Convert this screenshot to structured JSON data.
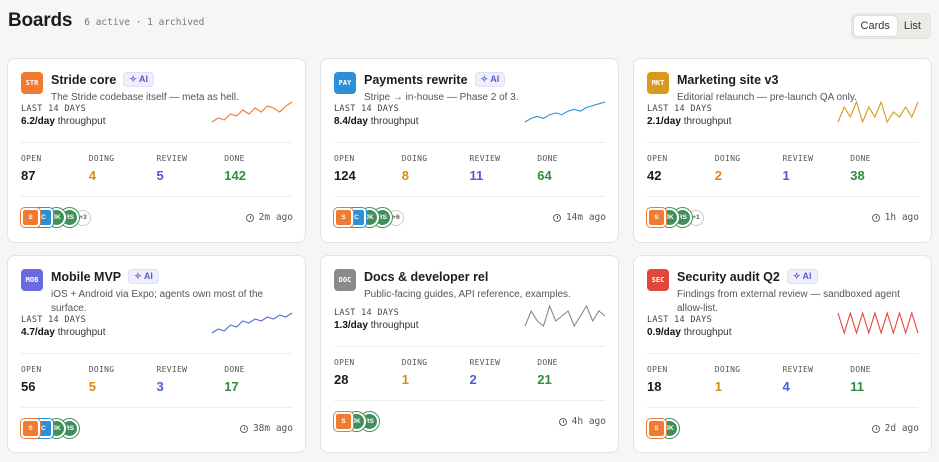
{
  "header": {
    "title": "Boards",
    "subtitle": "6 active · 1 archived"
  },
  "view_toggle": {
    "options": [
      "Cards",
      "List"
    ],
    "active": "Cards"
  },
  "labels": {
    "last14": "LAST 14 DAYS",
    "throughput_suffix": "throughput",
    "open": "OPEN",
    "doing": "DOING",
    "review": "REVIEW",
    "done": "DONE",
    "ai": "✧ AI"
  },
  "colors": {
    "doing": "#d98a12",
    "review": "#4f5bd5",
    "done": "#2f8f3f",
    "ai": "#5b5bd6"
  },
  "boards": [
    {
      "code": "STR",
      "code_color": "#f07a2f",
      "name": "Stride core",
      "ai": true,
      "description": "The Stride codebase itself — meta as hell.",
      "rate": "6.2/day",
      "spark_color": "#f07a2f",
      "spark": [
        3,
        4,
        3.5,
        5,
        4.5,
        6,
        5,
        6.5,
        5.5,
        7,
        6.5,
        5.5,
        7,
        8
      ],
      "open": "87",
      "doing": "4",
      "review": "5",
      "done": "142",
      "avatars": [
        {
          "initials": "S",
          "color": "#f07a2f",
          "shape": "square"
        },
        {
          "initials": "C",
          "color": "#2c8fd8",
          "shape": "square"
        },
        {
          "initials": "JK",
          "color": "#3f8f5a",
          "shape": "circle"
        },
        {
          "initials": "RS",
          "color": "#3f8f5a",
          "shape": "circle"
        }
      ],
      "more": "+3",
      "updated": "2m ago"
    },
    {
      "code": "PAY",
      "code_color": "#2c8fd8",
      "name": "Payments rewrite",
      "ai": true,
      "description": "Stripe → in-house — Phase 2 of 3.",
      "rate": "8.4/day",
      "spark_color": "#2c8fd8",
      "spark": [
        2,
        3,
        3.5,
        3,
        4,
        4.5,
        4,
        5,
        5.5,
        5,
        6,
        6.5,
        7,
        7.5
      ],
      "open": "124",
      "doing": "8",
      "review": "11",
      "done": "64",
      "avatars": [
        {
          "initials": "S",
          "color": "#f07a2f",
          "shape": "square"
        },
        {
          "initials": "C",
          "color": "#2c8fd8",
          "shape": "square"
        },
        {
          "initials": "JK",
          "color": "#3f8f5a",
          "shape": "circle"
        },
        {
          "initials": "RS",
          "color": "#3f8f5a",
          "shape": "circle"
        }
      ],
      "more": "+6",
      "updated": "14m ago"
    },
    {
      "code": "MKT",
      "code_color": "#d99a1b",
      "name": "Marketing site v3",
      "ai": false,
      "description": "Editorial relaunch — pre-launch QA only.",
      "rate": "2.1/day",
      "spark_color": "#d99a1b",
      "spark": [
        3,
        6,
        4,
        7,
        3,
        6,
        4,
        7,
        3,
        5,
        4,
        6,
        4,
        7
      ],
      "open": "42",
      "doing": "2",
      "review": "1",
      "done": "38",
      "avatars": [
        {
          "initials": "S",
          "color": "#f07a2f",
          "shape": "square"
        },
        {
          "initials": "JK",
          "color": "#3f8f5a",
          "shape": "circle"
        },
        {
          "initials": "RS",
          "color": "#3f8f5a",
          "shape": "circle"
        }
      ],
      "more": "+1",
      "updated": "1h ago"
    },
    {
      "code": "MOB",
      "code_color": "#6a6ae0",
      "name": "Mobile MVP",
      "ai": true,
      "description": "iOS + Android via Expo; agents own most of the surface.",
      "rate": "4.7/day",
      "spark_color": "#4f6fd8",
      "spark": [
        2,
        3,
        2.5,
        4,
        3.5,
        5,
        4.5,
        5.5,
        5,
        6,
        5.5,
        6.5,
        6,
        7
      ],
      "open": "56",
      "doing": "5",
      "review": "3",
      "done": "17",
      "avatars": [
        {
          "initials": "S",
          "color": "#f07a2f",
          "shape": "square"
        },
        {
          "initials": "C",
          "color": "#2c8fd8",
          "shape": "square"
        },
        {
          "initials": "JK",
          "color": "#3f8f5a",
          "shape": "circle"
        },
        {
          "initials": "RS",
          "color": "#3f8f5a",
          "shape": "circle"
        }
      ],
      "more": "",
      "updated": "38m ago"
    },
    {
      "code": "DOC",
      "code_color": "#8a8a8a",
      "name": "Docs & developer rel",
      "ai": false,
      "description": "Public-facing guides, API reference, examples.",
      "rate": "1.3/day",
      "spark_color": "#8a8a8a",
      "spark": [
        3,
        6,
        4,
        3,
        7,
        4,
        5,
        6,
        3,
        5,
        7,
        4,
        6,
        5
      ],
      "open": "28",
      "doing": "1",
      "review": "2",
      "done": "21",
      "avatars": [
        {
          "initials": "S",
          "color": "#f07a2f",
          "shape": "square"
        },
        {
          "initials": "JK",
          "color": "#3f8f5a",
          "shape": "circle"
        },
        {
          "initials": "RS",
          "color": "#3f8f5a",
          "shape": "circle"
        }
      ],
      "more": "",
      "updated": "4h ago"
    },
    {
      "code": "SEC",
      "code_color": "#e0483d",
      "name": "Security audit Q2",
      "ai": true,
      "description": "Findings from external review — sandboxed agent allow-list.",
      "rate": "0.9/day",
      "spark_color": "#e0483d",
      "spark": [
        8,
        2,
        8,
        2,
        8,
        2,
        8,
        2,
        8,
        2,
        8,
        2,
        8,
        2
      ],
      "open": "18",
      "doing": "1",
      "review": "4",
      "done": "11",
      "avatars": [
        {
          "initials": "S",
          "color": "#f07a2f",
          "shape": "square"
        },
        {
          "initials": "JK",
          "color": "#3f8f5a",
          "shape": "circle"
        }
      ],
      "more": "",
      "updated": "2d ago"
    }
  ]
}
